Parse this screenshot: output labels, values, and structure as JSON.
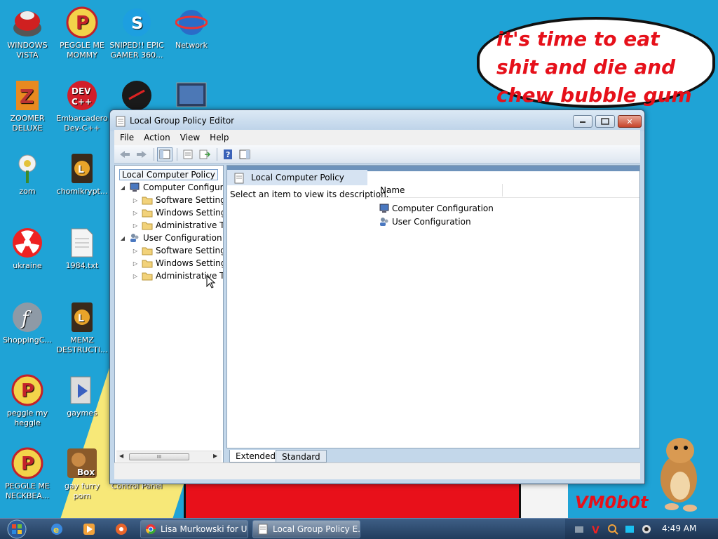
{
  "desktop": {
    "speech_bubble": "it's time to eat shit and die and chew bubble gum",
    "signature": "VM0b0t",
    "icons": [
      {
        "label": "WINDOWS VISTA",
        "icon": "windows-vista-icon"
      },
      {
        "label": "PEGGLE ME MOMMY",
        "icon": "peggle-icon"
      },
      {
        "label": "SNIPED!! EPIC GAMER 360...",
        "icon": "skype-icon"
      },
      {
        "label": "Network",
        "icon": "network-icon"
      },
      {
        "label": "ZOOMER DELUXE",
        "icon": "zoomer-icon"
      },
      {
        "label": "Embarcadero Dev-C++",
        "icon": "devcpp-icon"
      },
      {
        "label": "",
        "icon": "dark-app-icon"
      },
      {
        "label": "",
        "icon": "screen-app-icon"
      },
      {
        "label": "zom",
        "icon": "zombie-flower-icon"
      },
      {
        "label": "chomikrypt...",
        "icon": "lua-clock-icon"
      },
      {
        "label": "ukraine",
        "icon": "radiation-icon"
      },
      {
        "label": "1984.txt",
        "icon": "text-file-icon"
      },
      {
        "label": "ShoppingC...",
        "icon": "flash-icon"
      },
      {
        "label": "MEMZ DESTRUCTI...",
        "icon": "lua-clock-icon"
      },
      {
        "label": "peggle my heggle",
        "icon": "peggle-icon"
      },
      {
        "label": "gaymes",
        "icon": "media-folder-icon"
      },
      {
        "label": "PEGGLE ME NECKBEA...",
        "icon": "peggle-icon"
      },
      {
        "label": "gay furry porn",
        "icon": "box-beaver-icon"
      },
      {
        "label": "Control Panel",
        "icon": "control-panel-icon"
      }
    ],
    "box_label": "Box"
  },
  "window": {
    "title": "Local Group Policy Editor",
    "menu": [
      "File",
      "Action",
      "View",
      "Help"
    ],
    "tree": {
      "root": "Local Computer Policy",
      "computer_config": "Computer Configura",
      "user_config": "User Configuration",
      "children": [
        "Software Settings",
        "Windows Setting",
        "Administrative Te"
      ],
      "scroll_grip": "III"
    },
    "right_pane": {
      "header": "Local Computer Policy",
      "description": "Select an item to view its description.",
      "column_name": "Name",
      "items": [
        "Computer Configuration",
        "User Configuration"
      ]
    },
    "tabs": [
      "Extended",
      "Standard"
    ]
  },
  "taskbar": {
    "buttons": [
      "Lisa Murkowski for U...",
      "Local Group Policy E..."
    ],
    "clock": "4:49 AM"
  }
}
